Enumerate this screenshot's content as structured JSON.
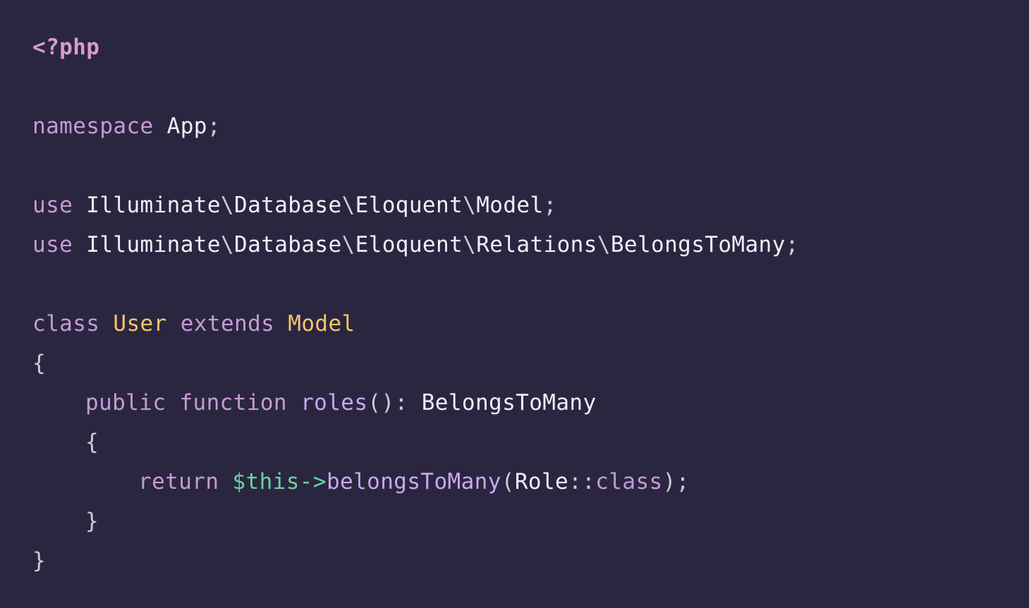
{
  "code": {
    "php_open_tag": "<?php",
    "namespace_keyword": "namespace",
    "namespace_name": "App",
    "semicolon": ";",
    "use_keyword": "use",
    "use1": {
      "seg1": "Illuminate",
      "seg2": "Database",
      "seg3": "Eloquent",
      "seg4": "Model"
    },
    "use2": {
      "seg1": "Illuminate",
      "seg2": "Database",
      "seg3": "Eloquent",
      "seg4": "Relations",
      "seg5": "BelongsToMany"
    },
    "backslash": "\\",
    "class_keyword": "class",
    "class_name": "User",
    "extends_keyword": "extends",
    "parent_class": "Model",
    "open_brace": "{",
    "close_brace": "}",
    "public_keyword": "public",
    "function_keyword": "function",
    "method_name": "roles",
    "method_parens": "()",
    "return_colon": ":",
    "return_type": "BelongsToMany",
    "return_keyword": "return",
    "this_var": "$this",
    "arrow": "->",
    "call_name": "belongsToMany",
    "open_paren": "(",
    "arg_class": "Role",
    "scope_op": "::",
    "class_const": "class",
    "close_paren_semicolon": ");"
  },
  "colors": {
    "background": "#2b2640",
    "keyword": "#c49bd6",
    "type": "#f4c66b",
    "variable": "#6fd0a0",
    "text": "#f2eef6"
  }
}
